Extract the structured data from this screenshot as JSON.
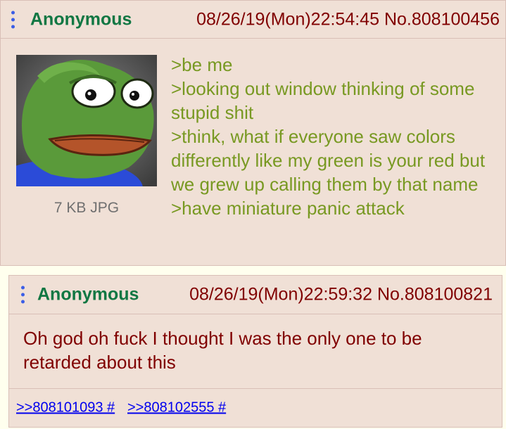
{
  "op": {
    "name": "Anonymous",
    "datetime": "08/26/19(Mon)22:54:45",
    "post_no": "No.808100456",
    "thumbnail_icon": "pepe-frog-image",
    "file_info": "7 KB JPG",
    "lines": [
      ">be me",
      ">looking out window thinking of some stupid shit",
      ">think, what if everyone saw colors differently like my green is your red but we grew up calling them by that name",
      ">have miniature panic attack"
    ]
  },
  "reply": {
    "name": "Anonymous",
    "datetime": "08/26/19(Mon)22:59:32",
    "post_no": "No.808100821",
    "text": "Oh god oh fuck I thought I was the only one to be retarded about this",
    "backlinks": [
      ">>808101093 #",
      ">>808102555 #"
    ]
  },
  "colors": {
    "name": "#117743",
    "greentext": "#789922",
    "text": "#800000",
    "link": "#0000ee",
    "post_bg": "#f0e0d6"
  }
}
